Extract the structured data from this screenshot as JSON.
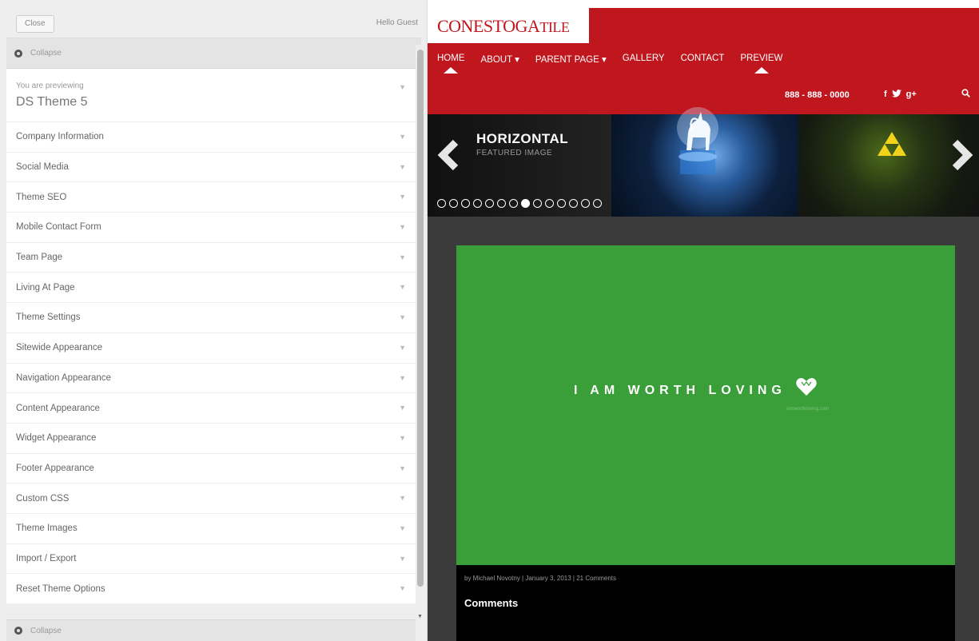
{
  "sidebar": {
    "close_label": "Close",
    "greeting": "Hello Guest",
    "collapse_label": "Collapse",
    "previewing_label": "You are previewing",
    "theme_name": "DS Theme 5",
    "sections": [
      {
        "label": "Company Information"
      },
      {
        "label": "Social Media"
      },
      {
        "label": "Theme SEO"
      },
      {
        "label": "Mobile Contact Form"
      },
      {
        "label": "Team Page"
      },
      {
        "label": "Living At Page"
      },
      {
        "label": "Theme Settings"
      },
      {
        "label": "Sitewide Appearance"
      },
      {
        "label": "Navigation Appearance"
      },
      {
        "label": "Content Appearance"
      },
      {
        "label": "Widget Appearance"
      },
      {
        "label": "Footer Appearance"
      },
      {
        "label": "Custom CSS"
      },
      {
        "label": "Theme Images"
      },
      {
        "label": "Import / Export"
      },
      {
        "label": "Reset Theme Options"
      }
    ],
    "section_arrow_icon": "chevron-down-icon"
  },
  "preview": {
    "logo_main": "CONESTOGA",
    "logo_tail": "TILE",
    "nav": [
      {
        "label": "HOME",
        "active": true
      },
      {
        "label": "ABOUT ▾",
        "active": false
      },
      {
        "label": "PARENT PAGE ▾",
        "active": false
      },
      {
        "label": "GALLERY",
        "active": false
      },
      {
        "label": "CONTACT",
        "active": false
      },
      {
        "label": "PREVIEW",
        "active": true
      }
    ],
    "phone": "888 - 888 - 0000",
    "social": [
      "f",
      "t",
      "g+"
    ],
    "slider": {
      "title": "HORIZONTAL",
      "subtitle": "FEATURED IMAGE",
      "dot_count": 14,
      "active_dot": 8
    },
    "post": {
      "headline": "I AM WORTH LOVING",
      "url": "iamworthloving.com",
      "meta": "by Michael Novotny | January 3, 2013 | 21 Comments",
      "comments_title": "Comments"
    },
    "colors": {
      "brand_red": "#c0161e",
      "post_green": "#3a9e39"
    }
  }
}
